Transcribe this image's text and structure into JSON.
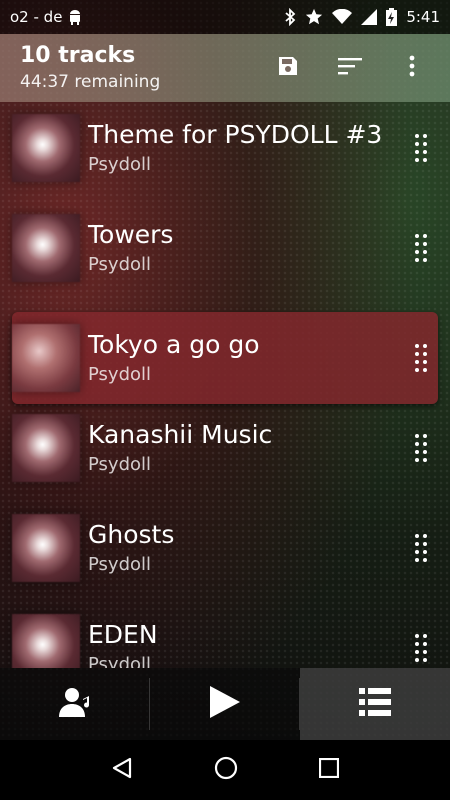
{
  "status_bar": {
    "carrier": "o2 - de",
    "time": "5:41",
    "icons": [
      "android-icon",
      "bluetooth-icon",
      "star-icon",
      "wifi-icon",
      "signal-icon",
      "battery-charging-icon"
    ]
  },
  "header": {
    "title": "10 tracks",
    "subtitle": "44:37 remaining",
    "actions": [
      "save-icon",
      "sort-icon",
      "more-icon"
    ]
  },
  "tracks": [
    {
      "title": "Theme for PSYDOLL #3",
      "artist": "Psydoll",
      "active": false
    },
    {
      "title": "Towers",
      "artist": "Psydoll",
      "active": false
    },
    {
      "title": "Tokyo a go go",
      "artist": "Psydoll",
      "active": true
    },
    {
      "title": "Kanashii Music",
      "artist": "Psydoll",
      "active": false
    },
    {
      "title": "Ghosts",
      "artist": "Psydoll",
      "active": false
    },
    {
      "title": "EDEN",
      "artist": "Psydoll",
      "active": false
    }
  ],
  "bottom_tabs": [
    {
      "icon": "artist-icon",
      "selected": false
    },
    {
      "icon": "play-icon",
      "selected": false
    },
    {
      "icon": "queue-list-icon",
      "selected": true
    }
  ],
  "nav_bar": [
    "back-icon",
    "home-icon",
    "recents-icon"
  ],
  "colors": {
    "active_row": "#82282d",
    "header_left": "#96786e",
    "header_right": "#6e8c6e"
  }
}
